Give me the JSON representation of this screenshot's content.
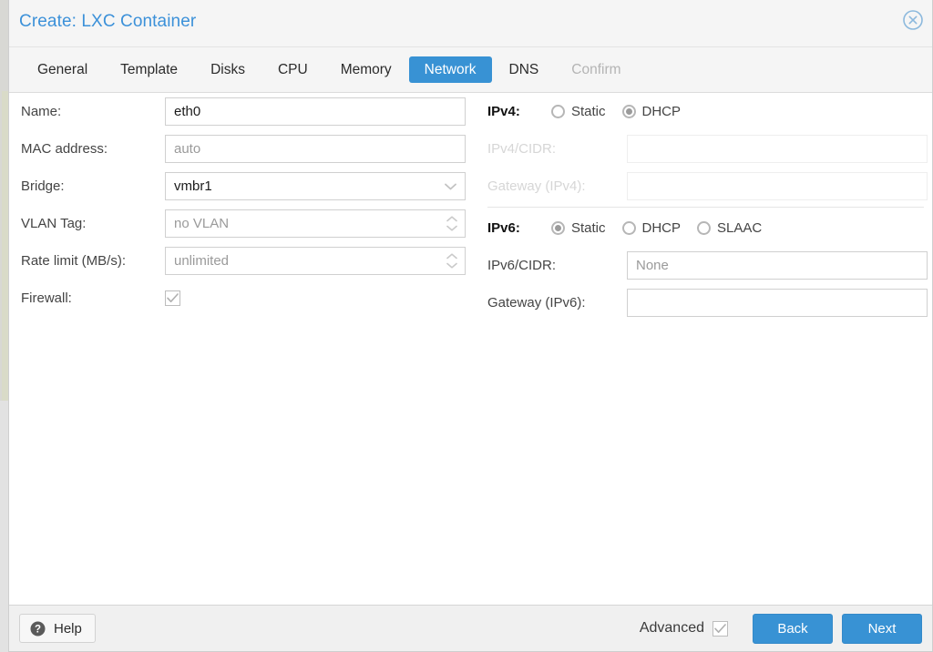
{
  "dialog": {
    "title": "Create: LXC Container",
    "close_icon": "close-circle-icon"
  },
  "tabs": [
    {
      "label": "General",
      "state": "normal"
    },
    {
      "label": "Template",
      "state": "normal"
    },
    {
      "label": "Disks",
      "state": "normal"
    },
    {
      "label": "CPU",
      "state": "normal"
    },
    {
      "label": "Memory",
      "state": "normal"
    },
    {
      "label": "Network",
      "state": "active"
    },
    {
      "label": "DNS",
      "state": "normal"
    },
    {
      "label": "Confirm",
      "state": "disabled"
    }
  ],
  "left_column": {
    "name": {
      "label": "Name:",
      "value": "eth0",
      "is_placeholder": false
    },
    "mac_address": {
      "label": "MAC address:",
      "value": "auto",
      "is_placeholder": true
    },
    "bridge": {
      "label": "Bridge:",
      "value": "vmbr1",
      "is_placeholder": false,
      "icon": "chevron-down-icon"
    },
    "vlan_tag": {
      "label": "VLAN Tag:",
      "value": "no VLAN",
      "is_placeholder": true,
      "icon": "spinner-updown-icon"
    },
    "rate_limit": {
      "label": "Rate limit (MB/s):",
      "value": "unlimited",
      "is_placeholder": true,
      "icon": "spinner-updown-icon"
    },
    "firewall": {
      "label": "Firewall:",
      "checked": true
    }
  },
  "right_column": {
    "ipv4": {
      "group_label": "IPv4:",
      "options": [
        {
          "label": "Static",
          "selected": false
        },
        {
          "label": "DHCP",
          "selected": true
        }
      ]
    },
    "ipv4_cidr": {
      "label": "IPv4/CIDR:",
      "value": "",
      "disabled": true
    },
    "ipv4_gateway": {
      "label": "Gateway (IPv4):",
      "value": "",
      "disabled": true
    },
    "ipv6": {
      "group_label": "IPv6:",
      "options": [
        {
          "label": "Static",
          "selected": true
        },
        {
          "label": "DHCP",
          "selected": false
        },
        {
          "label": "SLAAC",
          "selected": false
        }
      ]
    },
    "ipv6_cidr": {
      "label": "IPv6/CIDR:",
      "value": "None",
      "is_placeholder": true,
      "disabled": false
    },
    "ipv6_gateway": {
      "label": "Gateway (IPv6):",
      "value": "",
      "disabled": false
    }
  },
  "footer": {
    "help_label": "Help",
    "help_icon": "question-circle-icon",
    "advanced_label": "Advanced",
    "advanced_checked": true,
    "back_label": "Back",
    "next_label": "Next"
  },
  "colors": {
    "accent_blue": "#3892d4",
    "title_blue": "#3c91d9",
    "placeholder_grey": "#9a9a9a",
    "disabled_grey": "#d6d6d6"
  }
}
